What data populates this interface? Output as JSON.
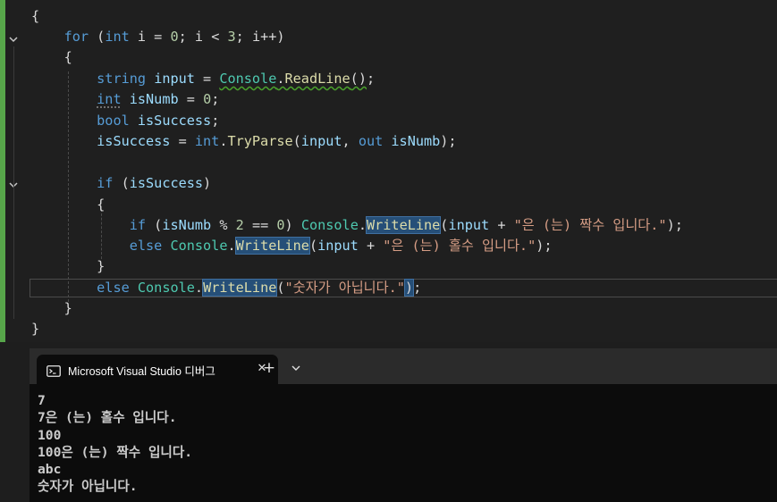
{
  "editor": {
    "lines": [
      {
        "tokens": [
          {
            "t": "{",
            "c": "pl"
          }
        ]
      },
      {
        "tokens": [
          {
            "t": "    ",
            "c": "pl"
          },
          {
            "t": "for",
            "c": "kw"
          },
          {
            "t": " (",
            "c": "pl"
          },
          {
            "t": "int",
            "c": "kw"
          },
          {
            "t": " i = ",
            "c": "pl"
          },
          {
            "t": "0",
            "c": "nu"
          },
          {
            "t": "; i < ",
            "c": "pl"
          },
          {
            "t": "3",
            "c": "nu"
          },
          {
            "t": "; i++)",
            "c": "pl"
          }
        ]
      },
      {
        "tokens": [
          {
            "t": "    {",
            "c": "pl"
          }
        ]
      },
      {
        "tokens": [
          {
            "t": "        ",
            "c": "pl"
          },
          {
            "t": "string",
            "c": "kw"
          },
          {
            "t": " ",
            "c": "pl"
          },
          {
            "t": "input",
            "c": "va"
          },
          {
            "t": " = ",
            "c": "pl"
          },
          {
            "t": "Console",
            "c": "ty squiggle"
          },
          {
            "t": ".",
            "c": "pl squiggle"
          },
          {
            "t": "ReadLine",
            "c": "me squiggle"
          },
          {
            "t": "()",
            "c": "pl squiggle"
          },
          {
            "t": ";",
            "c": "pl"
          }
        ]
      },
      {
        "tokens": [
          {
            "t": "        ",
            "c": "pl"
          },
          {
            "t": "int",
            "c": "kw dots"
          },
          {
            "t": " ",
            "c": "pl"
          },
          {
            "t": "isNumb",
            "c": "va"
          },
          {
            "t": " = ",
            "c": "pl"
          },
          {
            "t": "0",
            "c": "nu"
          },
          {
            "t": ";",
            "c": "pl"
          }
        ]
      },
      {
        "tokens": [
          {
            "t": "        ",
            "c": "pl"
          },
          {
            "t": "bool",
            "c": "kw"
          },
          {
            "t": " ",
            "c": "pl"
          },
          {
            "t": "isSuccess",
            "c": "va"
          },
          {
            "t": ";",
            "c": "pl"
          }
        ]
      },
      {
        "tokens": [
          {
            "t": "        ",
            "c": "pl"
          },
          {
            "t": "isSuccess",
            "c": "va"
          },
          {
            "t": " = ",
            "c": "pl"
          },
          {
            "t": "int",
            "c": "kw"
          },
          {
            "t": ".",
            "c": "pl"
          },
          {
            "t": "TryParse",
            "c": "me"
          },
          {
            "t": "(",
            "c": "pl"
          },
          {
            "t": "input",
            "c": "va"
          },
          {
            "t": ", ",
            "c": "pl"
          },
          {
            "t": "out",
            "c": "kw"
          },
          {
            "t": " ",
            "c": "pl"
          },
          {
            "t": "isNumb",
            "c": "va"
          },
          {
            "t": ");",
            "c": "pl"
          }
        ]
      },
      {
        "tokens": []
      },
      {
        "tokens": [
          {
            "t": "        ",
            "c": "pl"
          },
          {
            "t": "if",
            "c": "kw"
          },
          {
            "t": " (",
            "c": "pl"
          },
          {
            "t": "isSuccess",
            "c": "va"
          },
          {
            "t": ")",
            "c": "pl"
          }
        ]
      },
      {
        "tokens": [
          {
            "t": "        {",
            "c": "pl"
          }
        ]
      },
      {
        "tokens": [
          {
            "t": "            ",
            "c": "pl"
          },
          {
            "t": "if",
            "c": "kw"
          },
          {
            "t": " (",
            "c": "pl"
          },
          {
            "t": "isNumb",
            "c": "va"
          },
          {
            "t": " % ",
            "c": "pl"
          },
          {
            "t": "2",
            "c": "nu"
          },
          {
            "t": " == ",
            "c": "pl"
          },
          {
            "t": "0",
            "c": "nu"
          },
          {
            "t": ") ",
            "c": "pl"
          },
          {
            "t": "Console",
            "c": "ty"
          },
          {
            "t": ".",
            "c": "pl"
          },
          {
            "t": "WriteLine",
            "c": "me hl"
          },
          {
            "t": "(",
            "c": "pl"
          },
          {
            "t": "input",
            "c": "va"
          },
          {
            "t": " + ",
            "c": "pl"
          },
          {
            "t": "\"은 (는) 짝수 입니다.\"",
            "c": "st"
          },
          {
            "t": ");",
            "c": "pl"
          }
        ]
      },
      {
        "tokens": [
          {
            "t": "            ",
            "c": "pl"
          },
          {
            "t": "else",
            "c": "kw"
          },
          {
            "t": " ",
            "c": "pl"
          },
          {
            "t": "Console",
            "c": "ty"
          },
          {
            "t": ".",
            "c": "pl"
          },
          {
            "t": "WriteLine",
            "c": "me hl"
          },
          {
            "t": "(",
            "c": "pl"
          },
          {
            "t": "input",
            "c": "va"
          },
          {
            "t": " + ",
            "c": "pl"
          },
          {
            "t": "\"은 (는) 홀수 입니다.\"",
            "c": "st"
          },
          {
            "t": ");",
            "c": "pl"
          }
        ]
      },
      {
        "tokens": [
          {
            "t": "        }",
            "c": "pl"
          }
        ]
      },
      {
        "tokens": [
          {
            "t": "        ",
            "c": "pl"
          },
          {
            "t": "else",
            "c": "kw"
          },
          {
            "t": " ",
            "c": "pl"
          },
          {
            "t": "Console",
            "c": "ty"
          },
          {
            "t": ".",
            "c": "pl"
          },
          {
            "t": "WriteLine",
            "c": "me hl"
          },
          {
            "t": "(",
            "c": "pl"
          },
          {
            "t": "\"숫자가 아닙니다.\"",
            "c": "st"
          },
          {
            "t": ")",
            "c": "pl hl"
          },
          {
            "t": ";",
            "c": "pl"
          }
        ]
      },
      {
        "tokens": [
          {
            "t": "    }",
            "c": "pl"
          }
        ]
      },
      {
        "tokens": [
          {
            "t": "}",
            "c": "pl"
          }
        ]
      }
    ]
  },
  "terminal": {
    "tab_title": "Microsoft Visual Studio 디버그",
    "tab_icon": "terminal-icon",
    "close_label": "✕",
    "new_tab_label": "+",
    "dropdown_icon": "chevron-down-icon",
    "output": [
      "7",
      "7은 (는) 홀수 입니다.",
      "100",
      "100은 (는) 짝수 입니다.",
      "abc",
      "숫자가 아닙니다."
    ]
  },
  "colors": {
    "keyword": "#569cd6",
    "type": "#4ec9b0",
    "method": "#dcdcaa",
    "string": "#d69d85",
    "number": "#b5cea8",
    "variable": "#9cdcfe",
    "change_bar": "#57a64a"
  }
}
